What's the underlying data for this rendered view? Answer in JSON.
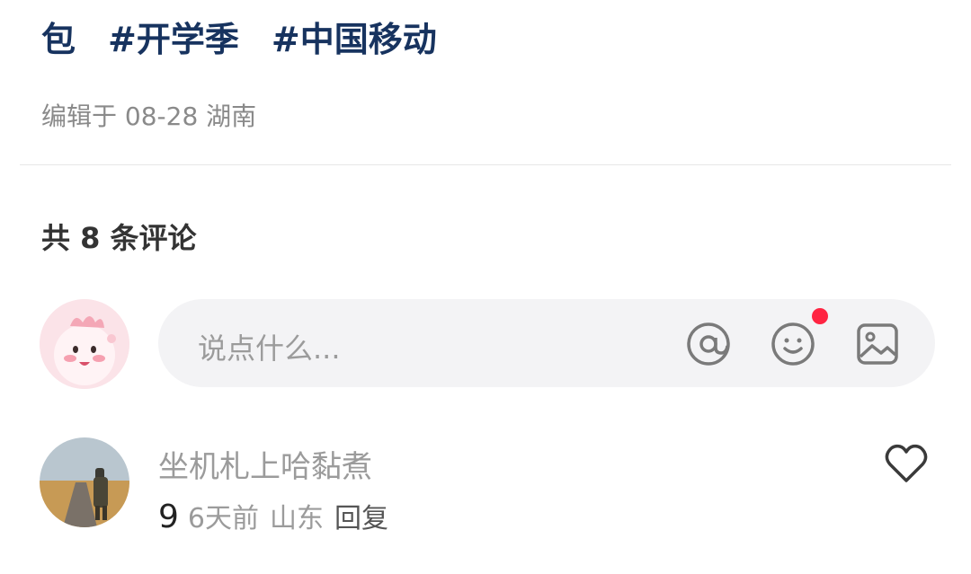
{
  "post": {
    "tags": [
      "包",
      "#开学季",
      "#中国移动"
    ],
    "edit_info": "编辑于 08-28 湖南"
  },
  "comments_section": {
    "count_label": "共 8 条评论",
    "input": {
      "placeholder": "说点什么...",
      "icons": [
        "at-icon",
        "emoji-icon",
        "image-icon"
      ]
    }
  },
  "comments": [
    {
      "user": "坐机札上哈黏煮",
      "text": "9",
      "time": "6天前",
      "location": "山东",
      "reply_label": "回复"
    }
  ],
  "colors": {
    "tag": "#17335f",
    "notify_dot": "#ff2442",
    "input_bg": "#f3f3f5"
  }
}
